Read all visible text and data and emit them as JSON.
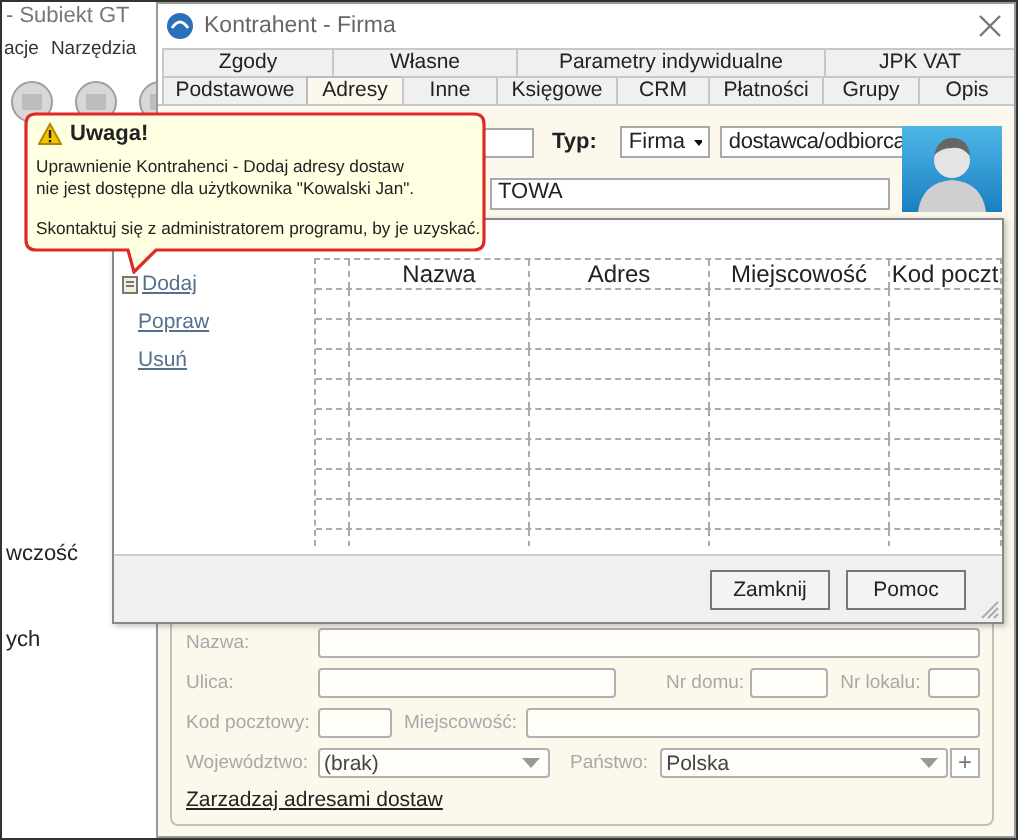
{
  "background_app": {
    "title": "- Subiekt GT",
    "menu": [
      "acje",
      "Narzędzia"
    ],
    "side_labels": [
      "wczość",
      "ych"
    ]
  },
  "window": {
    "title": "Kontrahent - Firma"
  },
  "tab_rows": [
    [
      {
        "label": "Zgody",
        "selected": false
      },
      {
        "label": "Własne",
        "selected": false
      },
      {
        "label": "Parametry indywidualne",
        "selected": false
      },
      {
        "label": "JPK VAT",
        "selected": false
      }
    ],
    [
      {
        "label": "Podstawowe",
        "selected": false
      },
      {
        "label": "Adresy",
        "selected": true
      },
      {
        "label": "Inne",
        "selected": false
      },
      {
        "label": "Księgowe",
        "selected": false
      },
      {
        "label": "CRM",
        "selected": false
      },
      {
        "label": "Płatności",
        "selected": false
      },
      {
        "label": "Grupy",
        "selected": false
      },
      {
        "label": "Opis",
        "selected": false
      }
    ]
  ],
  "header": {
    "typ_label": "Typ:",
    "typ_value": "Firma",
    "role_value": "dostawca/odbiorca",
    "name_value": "TOWA"
  },
  "address_form": {
    "disabled": true,
    "name_label": "Nazwa:",
    "street_label": "Ulica:",
    "house_label": "Nr domu:",
    "flat_label": "Nr lokalu:",
    "postcode_label": "Kod pocztowy:",
    "city_label": "Miejscowość:",
    "region_label": "Województwo:",
    "region_value": "(brak)",
    "country_label": "Państwo:",
    "country_value": "Polska",
    "add_button": "+",
    "manage_link": "Zarzadzaj adresami dostaw"
  },
  "dialog": {
    "actions": [
      "Dodaj",
      "Popraw",
      "Usuń"
    ],
    "columns": [
      "Nazwa",
      "Adres",
      "Miejscowość",
      "Kod poczt"
    ],
    "buttons": [
      "Zamknij",
      "Pomoc"
    ]
  },
  "tooltip": {
    "title": "Uwaga!",
    "lines": [
      "Uprawnienie Kontrahenci - Dodaj adresy dostaw",
      "nie jest dostępne dla użytkownika \"Kowalski Jan\"."
    ],
    "note": "Skontaktuj się z administratorem programu, by je uzyskać."
  }
}
